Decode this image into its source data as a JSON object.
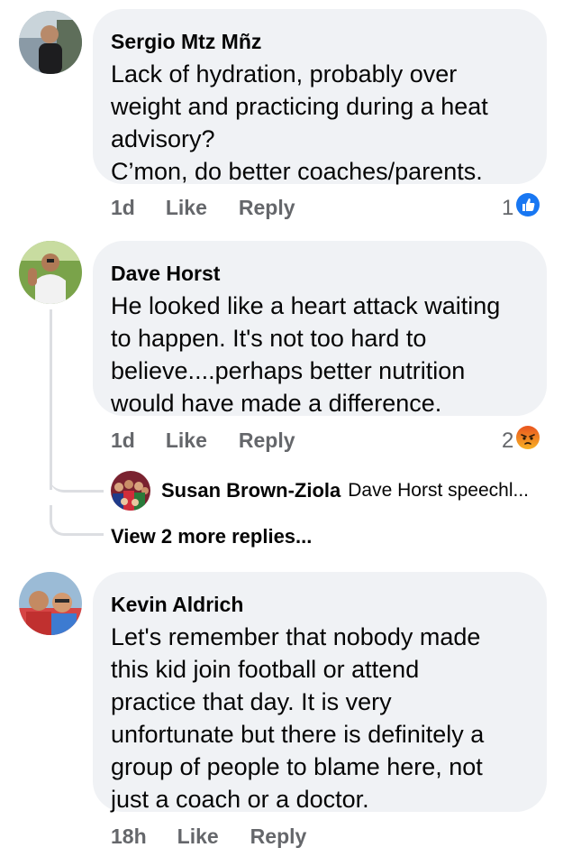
{
  "comments": [
    {
      "author": "Sergio Mtz Mñz",
      "lines": [
        "Lack of hydration, probably over",
        "weight and practicing during a heat",
        "advisory?",
        "C’mon, do better coaches/parents."
      ],
      "time": "1d",
      "like_label": "Like",
      "reply_label": "Reply",
      "reaction_count": "1",
      "reaction_icon": "like-icon",
      "reaction_color": "#1877f2"
    },
    {
      "author": "Dave Horst",
      "lines": [
        "He looked like a heart attack waiting",
        "to happen. It's not too hard to",
        "believe....perhaps better nutrition",
        "would have made a difference."
      ],
      "time": "1d",
      "like_label": "Like",
      "reply_label": "Reply",
      "reaction_count": "2",
      "reaction_icon": "angry-icon",
      "reaction_color": "#f15a22",
      "reply_preview": {
        "author": "Susan Brown-Ziola",
        "text": "Dave Horst speechl..."
      },
      "view_more": "View 2 more replies..."
    },
    {
      "author": "Kevin Aldrich",
      "lines": [
        "Let's remember that nobody made",
        "this kid join football or attend",
        "practice that day. It is very",
        "unfortunate but there is definitely a",
        "group of people to blame here, not",
        "just a coach or a doctor."
      ],
      "time": "18h",
      "like_label": "Like",
      "reply_label": "Reply"
    }
  ],
  "colors": {
    "bubble_bg": "#f0f2f5",
    "meta_text": "#65676b",
    "text": "#050505"
  }
}
